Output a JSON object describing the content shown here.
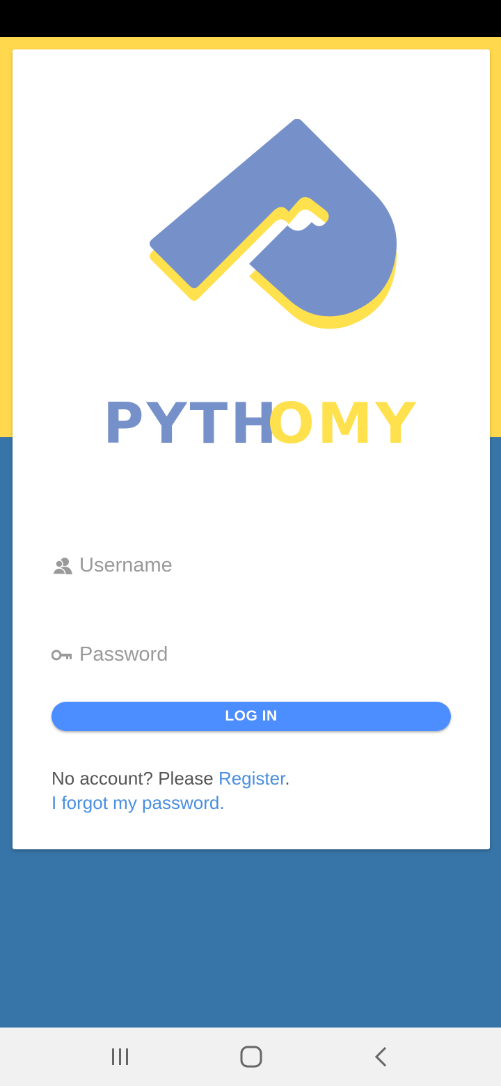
{
  "colors": {
    "yellow": "#ffd84d",
    "blue": "#3774a7",
    "logo_blue": "#7690c9",
    "logo_yellow": "#ffe14d",
    "button_blue": "#4c8dff",
    "link_blue": "#4a8ee0"
  },
  "logo": {
    "text_part1": "PYTH",
    "text_part2": "OMY"
  },
  "form": {
    "username_placeholder": "Username",
    "username_icon": "users-icon",
    "password_placeholder": "Password",
    "password_icon": "key-icon",
    "login_label": "LOG IN"
  },
  "links": {
    "no_account_text": "No account? Please ",
    "register_label": "Register",
    "period": ".",
    "forgot_label": "I forgot my password."
  },
  "navbar": {
    "recent_icon": "recent-apps-icon",
    "home_icon": "home-icon",
    "back_icon": "back-icon"
  }
}
